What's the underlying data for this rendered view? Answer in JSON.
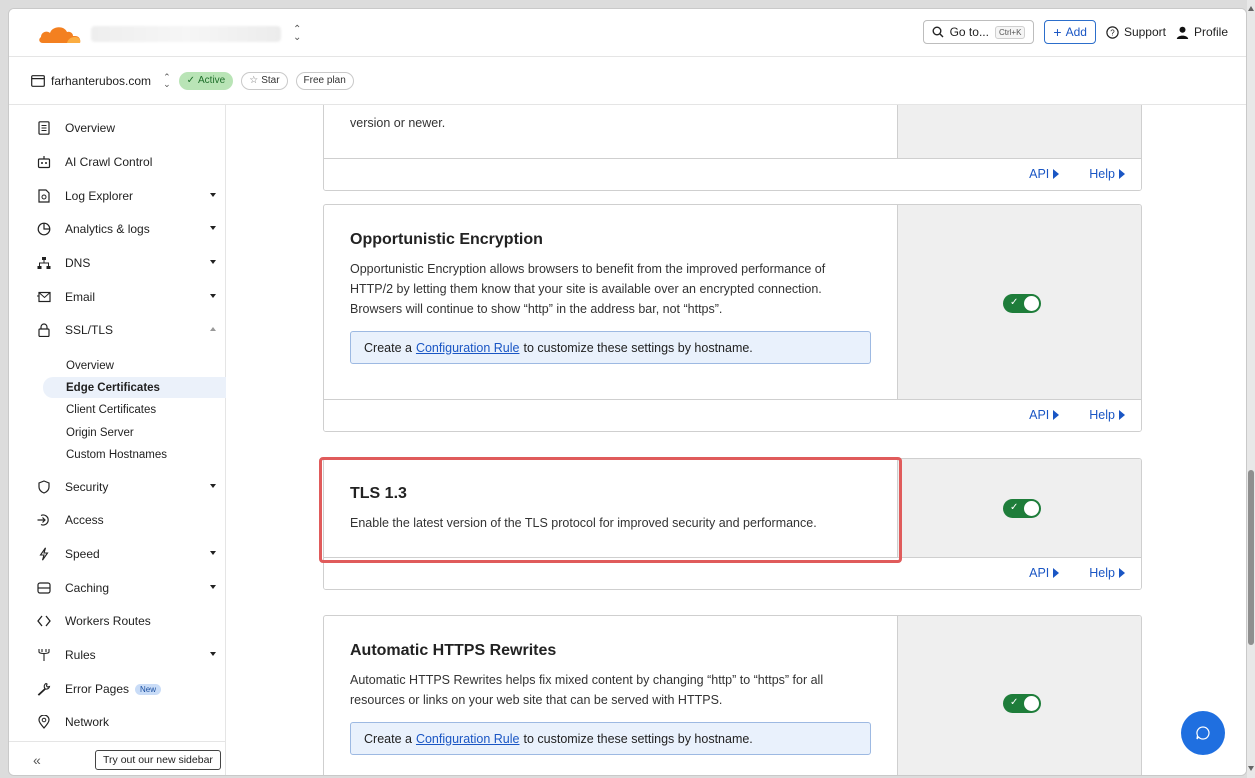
{
  "topbar": {
    "goto_label": "Go to...",
    "goto_shortcut": "Ctrl+K",
    "add_label": "Add",
    "support_label": "Support",
    "profile_label": "Profile"
  },
  "zone": {
    "name": "farhanterubos.com",
    "status": "Active",
    "star_label": "Star",
    "plan": "Free plan"
  },
  "sidebar": {
    "items": [
      {
        "label": "Overview",
        "icon": "document-icon"
      },
      {
        "label": "AI Crawl Control",
        "icon": "robot-icon"
      },
      {
        "label": "Log Explorer",
        "icon": "file-search-icon"
      },
      {
        "label": "Analytics & logs",
        "icon": "pie-chart-icon"
      },
      {
        "label": "DNS",
        "icon": "network-tree-icon"
      },
      {
        "label": "Email",
        "icon": "envelope-icon"
      },
      {
        "label": "SSL/TLS",
        "icon": "lock-icon"
      },
      {
        "label": "Security",
        "icon": "shield-icon"
      },
      {
        "label": "Access",
        "icon": "sign-in-icon"
      },
      {
        "label": "Speed",
        "icon": "bolt-icon"
      },
      {
        "label": "Caching",
        "icon": "server-icon"
      },
      {
        "label": "Workers Routes",
        "icon": "code-brackets-icon"
      },
      {
        "label": "Rules",
        "icon": "fork-icon"
      },
      {
        "label": "Error Pages",
        "icon": "wrench-icon",
        "badge": "New"
      },
      {
        "label": "Network",
        "icon": "location-pin-icon"
      }
    ],
    "ssl_sub": [
      "Overview",
      "Edge Certificates",
      "Client Certificates",
      "Origin Server",
      "Custom Hostnames"
    ],
    "try_label": "Try out our new sidebar"
  },
  "cards": {
    "stub": {
      "text": "version or newer."
    },
    "opportunistic": {
      "title": "Opportunistic Encryption",
      "desc": "Opportunistic Encryption allows browsers to benefit from the improved performance of HTTP/2 by letting them know that your site is available over an encrypted connection. Browsers will continue to show “http” in the address bar, not “https”.",
      "config_pre": "Create a",
      "config_link": "Configuration Rule",
      "config_post": "to customize these settings by hostname.",
      "enabled": true
    },
    "tls13": {
      "title": "TLS 1.3",
      "desc": "Enable the latest version of the TLS protocol for improved security and performance.",
      "enabled": true
    },
    "https_rewrites": {
      "title": "Automatic HTTPS Rewrites",
      "desc": "Automatic HTTPS Rewrites helps fix mixed content by changing “http” to “https” for all resources or links on your web site that can be served with HTTPS.",
      "config_pre": "Create a",
      "config_link": "Configuration Rule",
      "config_post": "to customize these settings by hostname.",
      "enabled": true
    },
    "api_label": "API",
    "help_label": "Help"
  },
  "colors": {
    "accent": "#1a56c4",
    "toggle_on": "#1e7d3a",
    "highlight": "#e05b5b",
    "chat": "#1f6fe0"
  }
}
